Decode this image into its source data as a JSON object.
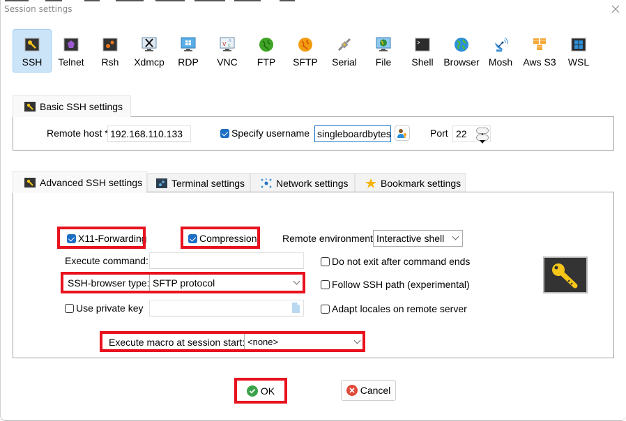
{
  "window": {
    "title": "Session settings",
    "close_icon": "close-icon"
  },
  "session_types": [
    {
      "label": "SSH",
      "icon": "ssh-key-icon",
      "active": true
    },
    {
      "label": "Telnet",
      "icon": "telnet-gem-icon",
      "active": false
    },
    {
      "label": "Rsh",
      "icon": "rsh-gears-icon",
      "active": false
    },
    {
      "label": "Xdmcp",
      "icon": "xdmcp-x-monitor-icon",
      "active": false
    },
    {
      "label": "RDP",
      "icon": "rdp-windows-monitor-icon",
      "active": false
    },
    {
      "label": "VNC",
      "icon": "vnc-monitor-icon",
      "active": false
    },
    {
      "label": "FTP",
      "icon": "ftp-green-globe-icon",
      "active": false
    },
    {
      "label": "SFTP",
      "icon": "sftp-orange-globe-icon",
      "active": false
    },
    {
      "label": "Serial",
      "icon": "serial-plug-icon",
      "active": false
    },
    {
      "label": "File",
      "icon": "file-globe-monitor-icon",
      "active": false
    },
    {
      "label": "Shell",
      "icon": "shell-terminal-icon",
      "active": false
    },
    {
      "label": "Browser",
      "icon": "browser-globe-icon",
      "active": false
    },
    {
      "label": "Mosh",
      "icon": "mosh-satellite-dish-icon",
      "active": false
    },
    {
      "label": "Aws S3",
      "icon": "aws-s3-cubes-icon",
      "active": false
    },
    {
      "label": "WSL",
      "icon": "wsl-windows-icon",
      "active": false
    }
  ],
  "basic": {
    "tab_label": "Basic SSH settings",
    "remote_host_label": "Remote host *",
    "remote_host_value": "192.168.110.133",
    "specify_username_label": "Specify username",
    "specify_username_checked": true,
    "username_value": "singleboardbytes",
    "user_manager_icon": "user-key-icon",
    "port_label": "Port",
    "port_value": "22"
  },
  "advanced_tabs": [
    {
      "label": "Advanced SSH settings",
      "icon": "key-icon",
      "selected": true
    },
    {
      "label": "Terminal settings",
      "icon": "terminal-gears-icon",
      "selected": false
    },
    {
      "label": "Network settings",
      "icon": "network-nodes-icon",
      "selected": false
    },
    {
      "label": "Bookmark settings",
      "icon": "star-icon",
      "selected": false
    }
  ],
  "advanced": {
    "x11_label": "X11-Forwarding",
    "x11_checked": true,
    "compression_label": "Compression",
    "compression_checked": true,
    "remote_env_label": "Remote environment:",
    "remote_env_value": "Interactive shell",
    "exec_command_label": "Execute command:",
    "exec_command_value": "",
    "do_not_exit_label": "Do not exit after command ends",
    "do_not_exit_checked": false,
    "browser_type_label": "SSH-browser type:",
    "browser_type_value": "SFTP protocol",
    "follow_path_label": "Follow SSH path (experimental)",
    "follow_path_checked": false,
    "private_key_label": "Use private key",
    "private_key_checked": false,
    "private_key_value": "",
    "adapt_locales_label": "Adapt locales on remote server",
    "adapt_locales_checked": false,
    "macro_label": "Execute macro at session start:",
    "macro_value": "<none>",
    "big_key_icon": "ssh-key-large-icon"
  },
  "buttons": {
    "ok_label": "OK",
    "cancel_label": "Cancel"
  },
  "colors": {
    "highlight_red": "#e8121f",
    "checkbox_blue": "#1d6ec4",
    "active_tab_blue": "#cce4f7"
  }
}
